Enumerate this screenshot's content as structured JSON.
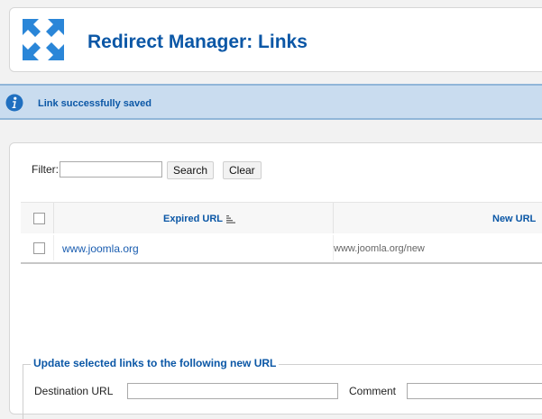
{
  "header": {
    "title": "Redirect Manager: Links",
    "icon": "redirect-arrows-icon"
  },
  "message": {
    "text": "Link successfully saved",
    "icon": "info-icon"
  },
  "filter": {
    "label": "Filter:",
    "value": "",
    "search_label": "Search",
    "clear_label": "Clear"
  },
  "table": {
    "columns": [
      "Expired URL",
      "New URL"
    ],
    "rows": [
      {
        "old_url": "www.joomla.org",
        "new_url": "www.joomla.org/new",
        "selected": false
      }
    ]
  },
  "batch": {
    "legend": "Update selected links to the following new URL",
    "destination_label": "Destination URL",
    "destination_value": "",
    "comment_label": "Comment",
    "comment_value": ""
  },
  "colors": {
    "accent": "#0b57a6",
    "message_bg": "#c9dcef",
    "panel_bg": "#ffffff"
  }
}
